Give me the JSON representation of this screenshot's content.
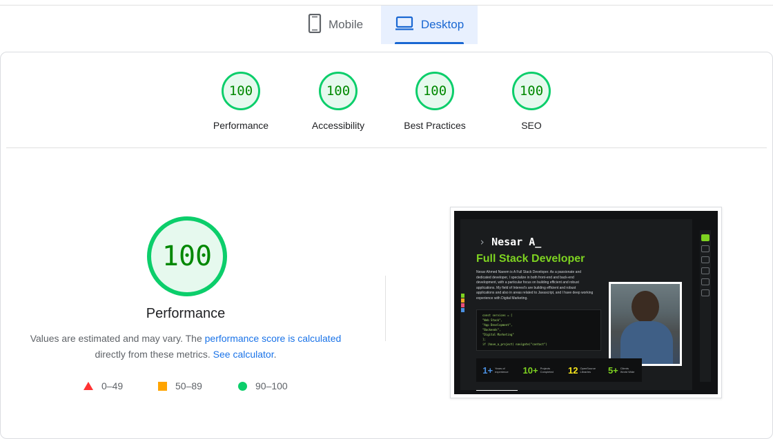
{
  "tabs": [
    {
      "label": "Mobile",
      "icon": "phone-icon",
      "active": false
    },
    {
      "label": "Desktop",
      "icon": "laptop-icon",
      "active": true
    }
  ],
  "gauges": [
    {
      "score": "100",
      "label": "Performance"
    },
    {
      "score": "100",
      "label": "Accessibility"
    },
    {
      "score": "100",
      "label": "Best Practices"
    },
    {
      "score": "100",
      "label": "SEO"
    }
  ],
  "performance": {
    "score": "100",
    "title": "Performance",
    "desc_pre": "Values are estimated and may vary. The ",
    "desc_link1": "performance score is calculated",
    "desc_mid": " directly from these metrics. ",
    "desc_link2": "See calculator",
    "desc_post": "."
  },
  "legend": [
    {
      "range": "0–49",
      "shape": "triangle",
      "color": "#ff3333"
    },
    {
      "range": "50–89",
      "shape": "square",
      "color": "#ffa400"
    },
    {
      "range": "90–100",
      "shape": "circle",
      "color": "#0cce6b"
    }
  ],
  "screenshot": {
    "name": "Nesar A_",
    "role": "Full Stack Developer",
    "bio": "Nesar Ahmed Naeem is A Full Stack Developer. As a passionate and dedicated developer, I specialize in both front-end and back-end development, with a particular focus on building efficient and robust applications. My field of Interest's are building efficient and robust applications and also in areas related to Javascript, and I have deep working experience with Digital Marketing.",
    "code_lines": [
      "const services = [",
      "  \"Web Stack\",",
      "  \"App Development\",",
      "  \"Backends\",",
      "  \"Digital Marketing\"",
      "];",
      "if (have_a_project) navigate(\"contact\")"
    ],
    "stats": [
      {
        "num": "1+",
        "label": "Years of experience",
        "color": "#4a90e2"
      },
      {
        "num": "10+",
        "label": "Projects Completed",
        "color": "#7ed321"
      },
      {
        "num": "12",
        "label": "OpenSource Libraries",
        "color": "#f8e71c"
      },
      {
        "num": "5+",
        "label": "Clients World Wide",
        "color": "#7ed321"
      }
    ]
  },
  "colors": {
    "pass": "#0cce6b",
    "pass_text": "#008800",
    "link": "#1a73e8",
    "tab_active": "#1967d2"
  }
}
